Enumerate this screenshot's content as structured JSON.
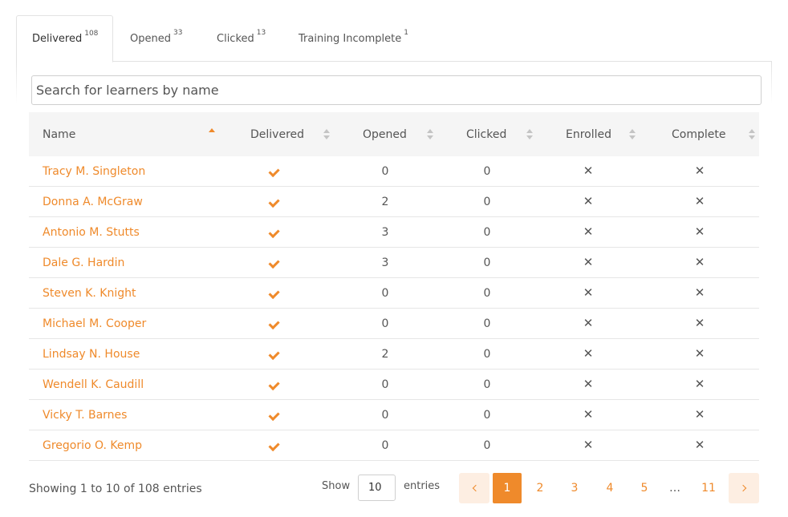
{
  "tabs": [
    {
      "label": "Delivered",
      "count": "108"
    },
    {
      "label": "Opened",
      "count": "33"
    },
    {
      "label": "Clicked",
      "count": "13"
    },
    {
      "label": "Training Incomplete",
      "count": "1"
    }
  ],
  "search": {
    "placeholder": "Search for learners by name",
    "value": ""
  },
  "table": {
    "columns": [
      "Name",
      "Delivered",
      "Opened",
      "Clicked",
      "Enrolled",
      "Complete"
    ],
    "sorted_column": "Name",
    "sort_direction": "ascending",
    "rows": [
      {
        "name": "Tracy M. Singleton",
        "delivered": "check",
        "opened": "0",
        "clicked": "0",
        "enrolled": "x",
        "complete": "x"
      },
      {
        "name": "Donna A. McGraw",
        "delivered": "check",
        "opened": "2",
        "clicked": "0",
        "enrolled": "x",
        "complete": "x"
      },
      {
        "name": "Antonio M. Stutts",
        "delivered": "check",
        "opened": "3",
        "clicked": "0",
        "enrolled": "x",
        "complete": "x"
      },
      {
        "name": "Dale G. Hardin",
        "delivered": "check",
        "opened": "3",
        "clicked": "0",
        "enrolled": "x",
        "complete": "x"
      },
      {
        "name": "Steven K. Knight",
        "delivered": "check",
        "opened": "0",
        "clicked": "0",
        "enrolled": "x",
        "complete": "x"
      },
      {
        "name": "Michael M. Cooper",
        "delivered": "check",
        "opened": "0",
        "clicked": "0",
        "enrolled": "x",
        "complete": "x"
      },
      {
        "name": "Lindsay N. House",
        "delivered": "check",
        "opened": "2",
        "clicked": "0",
        "enrolled": "x",
        "complete": "x"
      },
      {
        "name": "Wendell K. Caudill",
        "delivered": "check",
        "opened": "0",
        "clicked": "0",
        "enrolled": "x",
        "complete": "x"
      },
      {
        "name": "Vicky T. Barnes",
        "delivered": "check",
        "opened": "0",
        "clicked": "0",
        "enrolled": "x",
        "complete": "x"
      },
      {
        "name": "Gregorio O. Kemp",
        "delivered": "check",
        "opened": "0",
        "clicked": "0",
        "enrolled": "x",
        "complete": "x"
      }
    ]
  },
  "footer": {
    "info": "Showing 1 to 10 of 108 entries",
    "show_label": "Show",
    "page_size": "10",
    "entries_label": "entries"
  },
  "pagination": {
    "pages": [
      "1",
      "2",
      "3",
      "4",
      "5"
    ],
    "ellipsis": "…",
    "last_page": "11",
    "current": "1"
  },
  "colors": {
    "accent": "#ef8a2b",
    "accent_light": "#fdeee2",
    "header_bg": "#f5f5f5"
  },
  "icons": {
    "delivered": "check-icon",
    "not_done": "x-icon",
    "prev": "chevron-left-icon",
    "next": "chevron-right-icon"
  }
}
